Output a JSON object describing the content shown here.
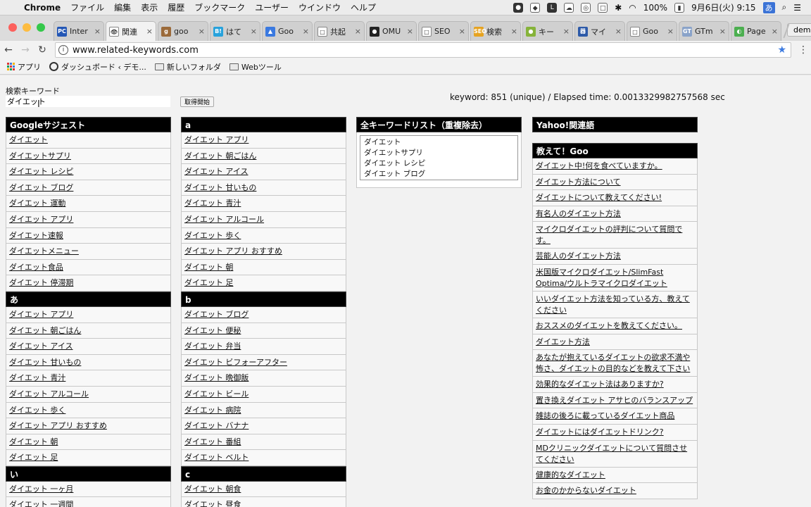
{
  "menubar": {
    "app": "Chrome",
    "menus": [
      "ファイル",
      "編集",
      "表示",
      "履歴",
      "ブックマーク",
      "ユーザー",
      "ウインドウ",
      "ヘルプ"
    ],
    "battery": "100%",
    "clock": "9月6日(火)  9:15",
    "ime": "あ"
  },
  "tabs": [
    {
      "label": "Inter",
      "fav": "PC",
      "color": "#2457b5"
    },
    {
      "label": "関連",
      "fav": "👁",
      "color": "#ffffff",
      "active": true
    },
    {
      "label": "goo",
      "fav": "g",
      "color": "#9b6a3a"
    },
    {
      "label": "はて",
      "fav": "B!",
      "color": "#27a2dc"
    },
    {
      "label": "Goo",
      "fav": "▲",
      "color": "#3a79e0"
    },
    {
      "label": "共起",
      "fav": "□",
      "color": "#ffffff"
    },
    {
      "label": "OMU",
      "fav": "●",
      "color": "#222222"
    },
    {
      "label": "SEO",
      "fav": "□",
      "color": "#ffffff"
    },
    {
      "label": "検索",
      "fav": "SEO",
      "color": "#e6a321"
    },
    {
      "label": "キー",
      "fav": "●",
      "color": "#86b33a"
    },
    {
      "label": "マイ",
      "fav": "器",
      "color": "#2d5aa8"
    },
    {
      "label": "Goo",
      "fav": "□",
      "color": "#ffffff"
    },
    {
      "label": "GTm",
      "fav": "GT",
      "color": "#8aa3c9"
    },
    {
      "label": "Page",
      "fav": "◐",
      "color": "#4caf50"
    }
  ],
  "profile": "demo",
  "url": "www.related-keywords.com",
  "bookmarks": [
    "アプリ",
    "ダッシュボード ‹ デモ...",
    "新しいフォルダ",
    "Webツール"
  ],
  "search": {
    "label": "検索キーワード",
    "value": "ダイエット",
    "button": "取得開始"
  },
  "stats": "keyword: 851 (unique) / Elapsed time: 0.0013329982757568 sec",
  "google_column": [
    {
      "header": "Googleサジェスト",
      "items": [
        "ダイエット",
        "ダイエットサプリ",
        "ダイエット レシピ",
        "ダイエット ブログ",
        "ダイエット 運動",
        "ダイエット アプリ",
        "ダイエット速報",
        "ダイエットメニュー",
        "ダイエット食品",
        "ダイエット 停滞期"
      ]
    },
    {
      "header": "あ",
      "items": [
        "ダイエット アプリ",
        "ダイエット 朝ごはん",
        "ダイエット アイス",
        "ダイエット 甘いもの",
        "ダイエット 青汁",
        "ダイエット アルコール",
        "ダイエット 歩く",
        "ダイエット アプリ おすすめ",
        "ダイエット 朝",
        "ダイエット 足"
      ]
    },
    {
      "header": "い",
      "items": [
        "ダイエット 一ヶ月",
        "ダイエット 一週間"
      ]
    }
  ],
  "alpha_column": [
    {
      "header": "a",
      "items": [
        "ダイエット アプリ",
        "ダイエット 朝ごはん",
        "ダイエット アイス",
        "ダイエット 甘いもの",
        "ダイエット 青汁",
        "ダイエット アルコール",
        "ダイエット 歩く",
        "ダイエット アプリ おすすめ",
        "ダイエット 朝",
        "ダイエット 足"
      ]
    },
    {
      "header": "b",
      "items": [
        "ダイエット ブログ",
        "ダイエット 便秘",
        "ダイエット 弁当",
        "ダイエット ビフォーアフター",
        "ダイエット 晩御飯",
        "ダイエット ビール",
        "ダイエット 病院",
        "ダイエット バナナ",
        "ダイエット 番組",
        "ダイエット ベルト"
      ]
    },
    {
      "header": "c",
      "items": [
        "ダイエット 朝食",
        "ダイエット 昼食"
      ]
    }
  ],
  "all_list": {
    "header": "全キーワードリスト（重複除去）",
    "lines": [
      "ダイエット",
      "ダイエットサプリ",
      "ダイエット レシピ",
      "ダイエット ブログ"
    ]
  },
  "yahoo": {
    "header": "Yahoo!関連語"
  },
  "goo": {
    "header": "教えて！Goo",
    "items": [
      "ダイエット中!何を食べていますか。",
      "ダイエット方法について",
      "ダイエットについて教えてください!",
      "有名人のダイエット方法",
      "マイクロダイエットの評判について質問です。",
      "芸能人のダイエット方法",
      "米国版マイクロダイエット/SlimFast Optima/ウルトラマイクロダイエット",
      "いいダイエット方法を知っている方、教えてください",
      "おススメのダイエットを教えてください。",
      "ダイエット方法",
      "あなたが抱えているダイエットの欲求不満や怖さ、ダイエットの目的などを教えて下さい",
      "効果的なダイエット法はありますか?",
      "置き換えダイエット アサヒのバランスアップ",
      "雑誌の後ろに載っているダイエット商品",
      "ダイエットにはダイエットドリンク?",
      "MDクリニックダイエットについて質問させてください",
      "健康的なダイエット",
      "お金のかからないダイエット"
    ]
  }
}
